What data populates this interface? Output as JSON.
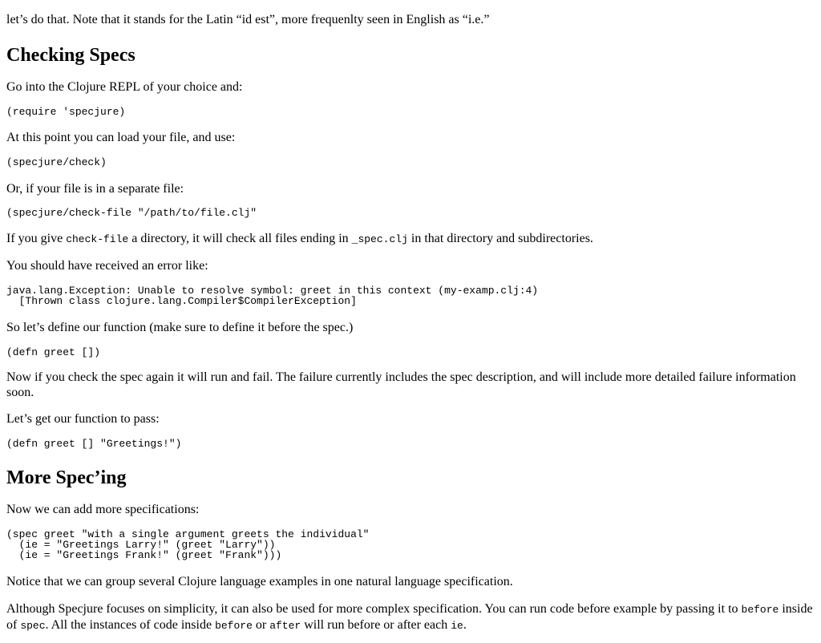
{
  "intro_text": "let’s do that. Note that it stands for the Latin “id est”, more frequenlty seen in English as “i.e.”",
  "checking": {
    "heading": "Checking Specs",
    "p1": "Go into the Clojure REPL of your choice and:",
    "code1": "(require 'specjure)",
    "p2": "At this point you can load your file, and use:",
    "code2": "(specjure/check)",
    "p3": "Or, if your file is in a separate file:",
    "code3": "(specjure/check-file \"/path/to/file.clj\"",
    "p4_a": "If you give ",
    "p4_code1": "check-file",
    "p4_b": " a directory, it will check all files ending in ",
    "p4_code2": "_spec.clj",
    "p4_c": " in that directory and subdirectories.",
    "p5": "You should have received an error like:",
    "code4": "java.lang.Exception: Unable to resolve symbol: greet in this context (my-examp.clj:4)\n  [Thrown class clojure.lang.Compiler$CompilerException]",
    "p6": "So let’s define our function (make sure to define it before the spec.)",
    "code5": "(defn greet [])",
    "p7": "Now if you check the spec again it will run and fail. The failure currently includes the spec description, and will include more detailed failure information soon.",
    "p8": "Let’s get our function to pass:",
    "code6": "(defn greet [] \"Greetings!\")"
  },
  "more": {
    "heading": "More Spec’ing",
    "p1": "Now we can add more specifications:",
    "code1": "(spec greet \"with a single argument greets the individual\"\n  (ie = \"Greetings Larry!\" (greet \"Larry\"))\n  (ie = \"Greetings Frank!\" (greet \"Frank\")))",
    "p2": "Notice that we can group several Clojure language examples in one natural language specification.",
    "p3_a": "Although Specjure focuses on simplicity, it can also be used for more complex specification. You can run code before example by passing it to ",
    "p3_code1": "before",
    "p3_b": " inside of ",
    "p3_code2": "spec",
    "p3_c": ". All the instances of code inside ",
    "p3_code3": "before",
    "p3_d": " or ",
    "p3_code4": "after",
    "p3_e": " will run before or after each ",
    "p3_code5": "ie",
    "p3_f": "."
  }
}
